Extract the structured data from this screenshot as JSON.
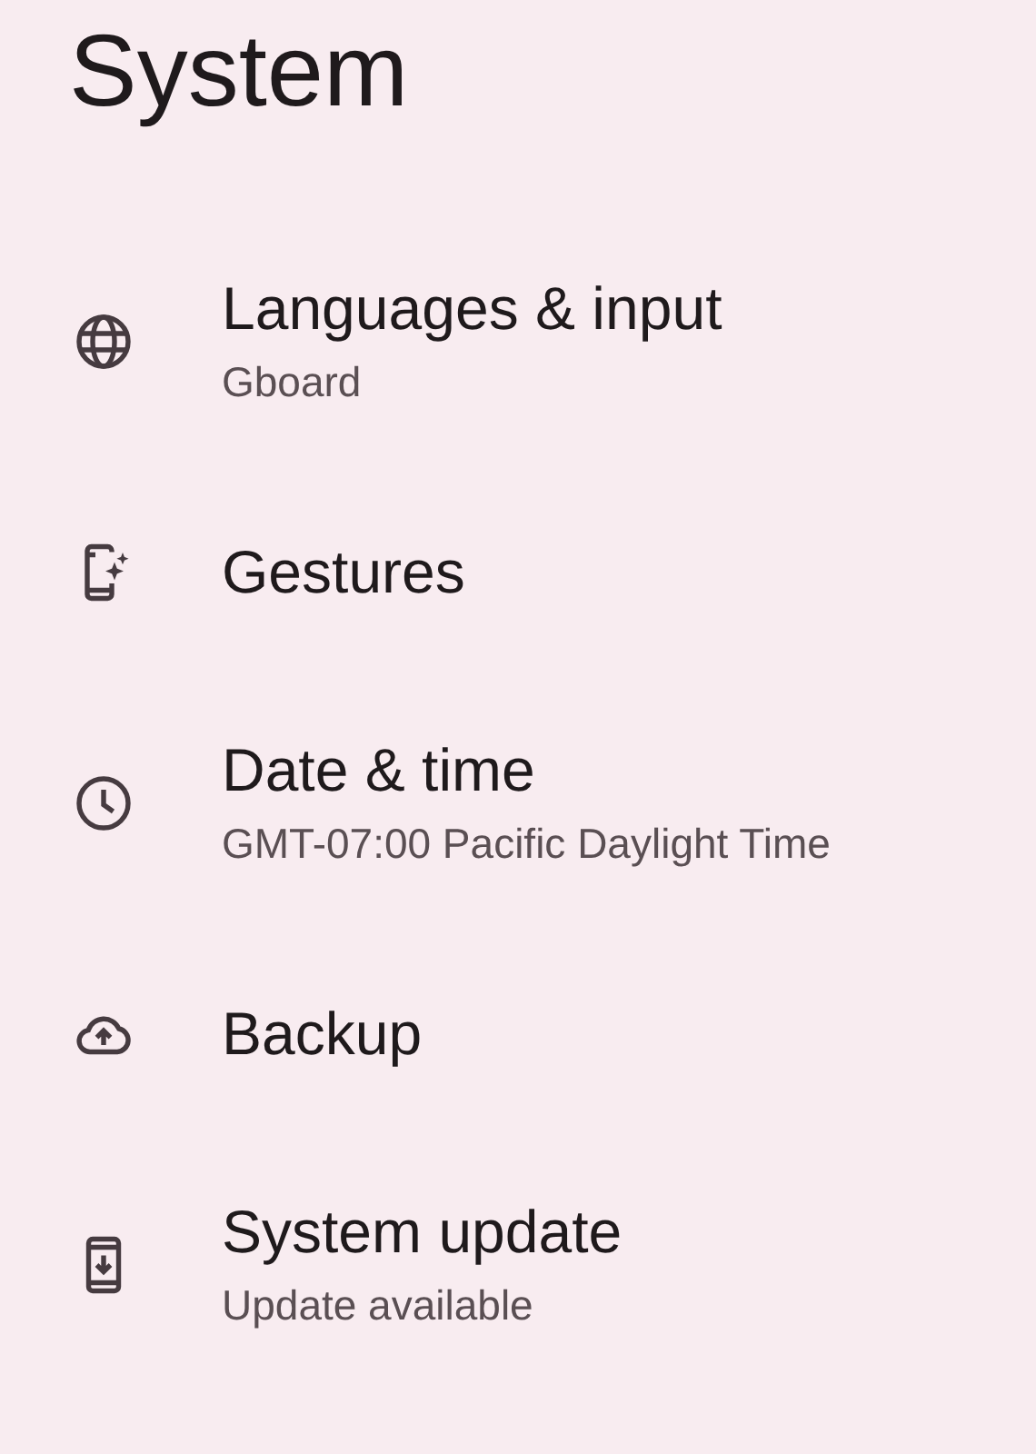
{
  "title": "System",
  "items": [
    {
      "kind": "globe",
      "title": "Languages & input",
      "subtitle": "Gboard"
    },
    {
      "kind": "gestures",
      "title": "Gestures"
    },
    {
      "kind": "clock",
      "title": "Date & time",
      "subtitle": "GMT-07:00 Pacific Daylight Time"
    },
    {
      "kind": "cloud",
      "title": "Backup"
    },
    {
      "kind": "update",
      "title": "System update",
      "subtitle": "Update available"
    }
  ]
}
